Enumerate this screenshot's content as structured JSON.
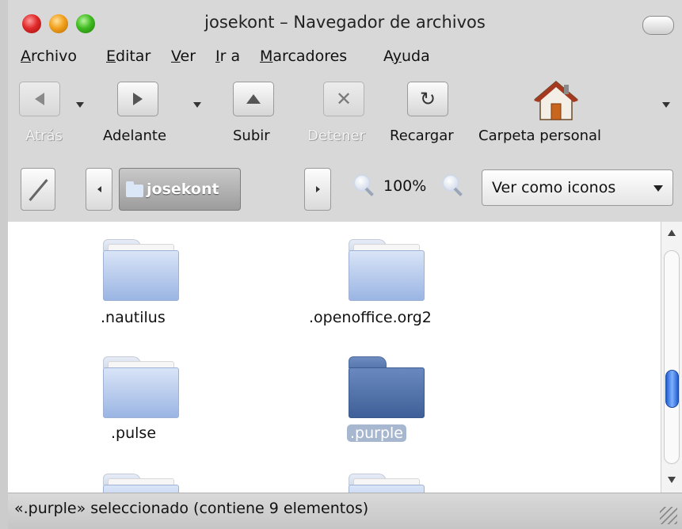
{
  "window": {
    "title": "josekont – Navegador de archivos"
  },
  "menu": {
    "items": [
      {
        "label": "Archivo",
        "u": "A",
        "rest": "rchivo"
      },
      {
        "label": "Editar",
        "u": "E",
        "rest": "ditar"
      },
      {
        "label": "Ver",
        "u": "V",
        "rest": "er"
      },
      {
        "label": "Ir a",
        "u": "I",
        "rest": "r a"
      },
      {
        "label": "Marcadores",
        "u": "M",
        "rest": "arcadores"
      },
      {
        "label": "Ayuda",
        "pre": "A",
        "u": "y",
        "rest": "uda"
      }
    ]
  },
  "toolbar": {
    "back_label": "Atrás",
    "forward_label": "Adelante",
    "up_label": "Subir",
    "stop_label": "Detener",
    "reload_label": "Recargar",
    "home_label": "Carpeta personal"
  },
  "location": {
    "path": "josekont",
    "zoom": "100%",
    "view_mode": "Ver como iconos"
  },
  "items": [
    {
      "name": ".nautilus",
      "selected": false
    },
    {
      "name": ".openoffice.org2",
      "selected": false
    },
    {
      "name": ".pulse",
      "selected": false
    },
    {
      "name": ".purple",
      "selected": true
    }
  ],
  "status": {
    "text": "«.purple» seleccionado (contiene 9 elementos)"
  },
  "colors": {
    "selection": "#a7b7cf",
    "folder_selected": "#4f6fa8",
    "scroll_thumb": "#2f6fe0"
  }
}
